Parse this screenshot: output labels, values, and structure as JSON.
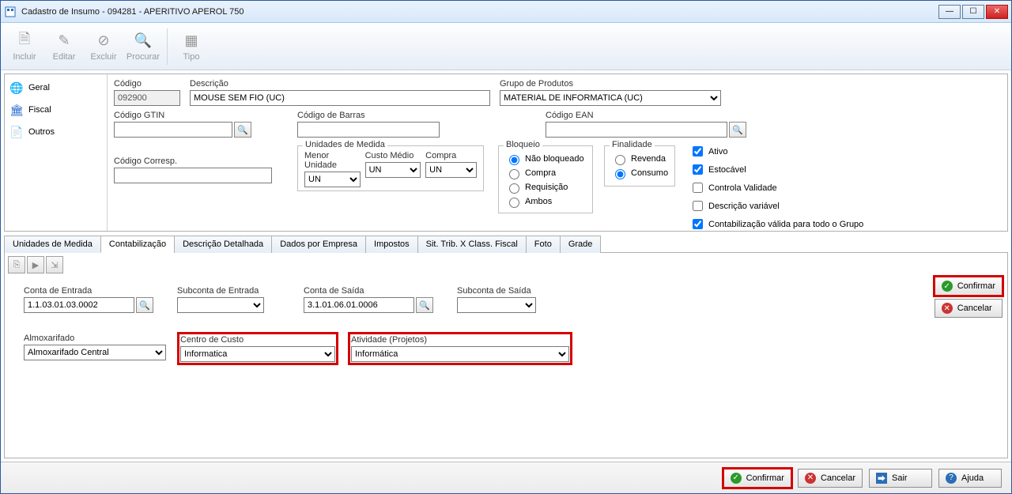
{
  "window": {
    "title": "Cadastro de Insumo - 094281 - APERITIVO APEROL 750"
  },
  "toolbar": {
    "incluir": "Incluir",
    "editar": "Editar",
    "excluir": "Excluir",
    "procurar": "Procurar",
    "tipo": "Tipo"
  },
  "sidenav": {
    "geral": "Geral",
    "fiscal": "Fiscal",
    "outros": "Outros"
  },
  "form": {
    "codigo_label": "Código",
    "codigo_value": "092900",
    "descricao_label": "Descrição",
    "descricao_value": "MOUSE SEM FIO (UC)",
    "grupo_label": "Grupo de Produtos",
    "grupo_value": "MATERIAL DE INFORMATICA (UC)",
    "codigo_gtin_label": "Código GTIN",
    "codigo_gtin_value": "",
    "codigo_barras_label": "Código de Barras",
    "codigo_barras_value": "",
    "codigo_ean_label": "Código EAN",
    "codigo_ean_value": "",
    "codigo_corresp_label": "Código Corresp.",
    "codigo_corresp_value": "",
    "unidades_legend": "Unidades de Medida",
    "menor_unidade_label": "Menor Unidade",
    "menor_unidade_value": "UN",
    "custo_medio_label": "Custo Médio",
    "custo_medio_value": "UN",
    "compra_label": "Compra",
    "compra_value": "UN",
    "bloqueio_legend": "Bloqueio",
    "bloqueio_nao": "Não bloqueado",
    "bloqueio_compra": "Compra",
    "bloqueio_requisicao": "Requisição",
    "bloqueio_ambos": "Ambos",
    "finalidade_legend": "Finalidade",
    "finalidade_revenda": "Revenda",
    "finalidade_consumo": "Consumo",
    "check_ativo": "Ativo",
    "check_estocavel": "Estocável",
    "check_validade": "Controla Validade",
    "check_desc_var": "Descrição variável",
    "check_contab": "Contabilização válida para todo o Grupo"
  },
  "tabs": {
    "t0": "Unidades de Medida",
    "t1": "Contabilização",
    "t2": "Descrição Detalhada",
    "t3": "Dados por Empresa",
    "t4": "Impostos",
    "t5": "Sit. Trib. X Class. Fiscal",
    "t6": "Foto",
    "t7": "Grade"
  },
  "contab": {
    "conta_entrada_label": "Conta de Entrada",
    "conta_entrada_value": "1.1.03.01.03.0002",
    "subconta_entrada_label": "Subconta de Entrada",
    "subconta_entrada_value": "",
    "conta_saida_label": "Conta de Saída",
    "conta_saida_value": "3.1.01.06.01.0006",
    "subconta_saida_label": "Subconta de Saída",
    "subconta_saida_value": "",
    "almoxarifado_label": "Almoxarifado",
    "almoxarifado_value": "Almoxarifado Central",
    "centro_custo_label": "Centro de Custo",
    "centro_custo_value": "Informatica",
    "atividade_label": "Atividade (Projetos)",
    "atividade_value": "Informática"
  },
  "buttons": {
    "confirmar": "Confirmar",
    "cancelar": "Cancelar",
    "sair": "Sair",
    "ajuda": "Ajuda"
  }
}
